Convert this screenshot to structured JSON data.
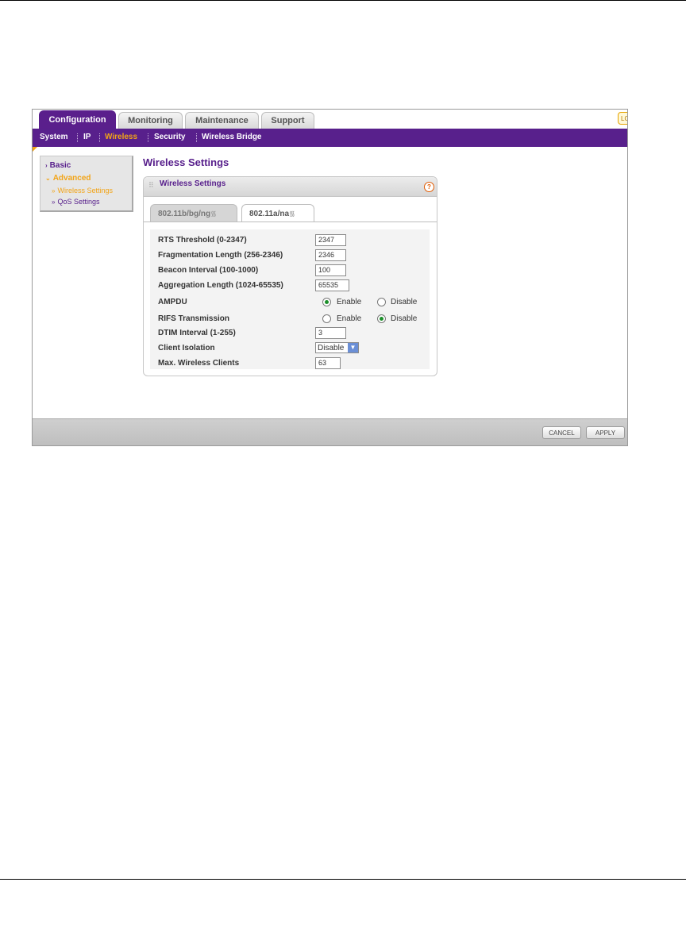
{
  "tabs": [
    {
      "label": "Configuration",
      "active": true
    },
    {
      "label": "Monitoring",
      "active": false
    },
    {
      "label": "Maintenance",
      "active": false
    },
    {
      "label": "Support",
      "active": false
    }
  ],
  "logout_label": "LO",
  "subnav": [
    {
      "label": "System",
      "active": false
    },
    {
      "label": "IP",
      "active": false
    },
    {
      "label": "Wireless",
      "active": true
    },
    {
      "label": "Security",
      "active": false
    },
    {
      "label": "Wireless Bridge",
      "active": false
    }
  ],
  "sidebar": {
    "basic": "Basic",
    "advanced": "Advanced",
    "wireless_settings": "Wireless Settings",
    "qos_settings": "QoS Settings"
  },
  "page_title": "Wireless Settings",
  "panel": {
    "title": "Wireless Settings",
    "help_glyph": "?",
    "subtabs": [
      {
        "label": "802.11b/bg/ng",
        "active": false
      },
      {
        "label": "802.11a/na",
        "active": true
      }
    ]
  },
  "form": {
    "rts_label": "RTS Threshold (0-2347)",
    "rts_value": "2347",
    "frag_label": "Fragmentation Length (256-2346)",
    "frag_value": "2346",
    "beacon_label": "Beacon Interval (100-1000)",
    "beacon_value": "100",
    "agg_label": "Aggregation Length (1024-65535)",
    "agg_value": "65535",
    "ampdu_label": "AMPDU",
    "ampdu_selected": "Enable",
    "rifs_label": "RIFS Transmission",
    "rifs_selected": "Disable",
    "enable_label": "Enable",
    "disable_label": "Disable",
    "dtim_label": "DTIM Interval (1-255)",
    "dtim_value": "3",
    "isolation_label": "Client Isolation",
    "isolation_value": "Disable",
    "maxclients_label": "Max. Wireless Clients",
    "maxclients_value": "63"
  },
  "buttons": {
    "cancel": "CANCEL",
    "apply": "APPLY"
  },
  "colors": {
    "brand_purple": "#58208c",
    "accent_orange": "#f2a417",
    "radio_green": "#1c8f2a"
  }
}
